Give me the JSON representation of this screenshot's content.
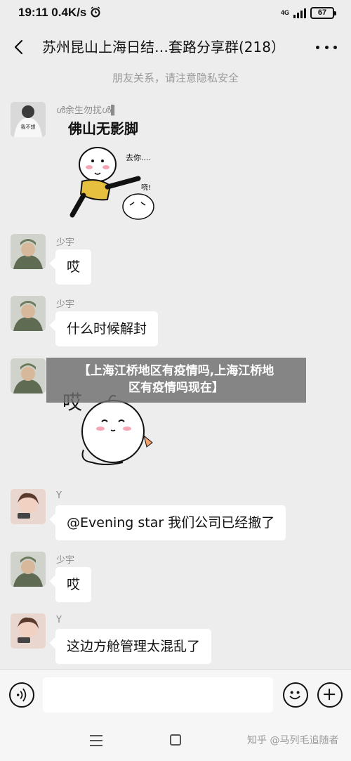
{
  "status": {
    "time": "19:11",
    "speed": "0.4K/s",
    "network": "4G",
    "battery": "67"
  },
  "header": {
    "title": "苏州昆山上海日结…套路分享群(218）"
  },
  "notice": "朋友关系，请注意隐私安全",
  "sticker_texts": {
    "foshan_title": "佛山无影脚",
    "qu_ni": "去你....",
    "xiao": "哓!",
    "ai": "哎"
  },
  "messages": [
    {
      "sender": "ൾ余生勿扰ൾ▌",
      "type": "sticker"
    },
    {
      "sender": "少宇",
      "text": "哎"
    },
    {
      "sender": "少宇",
      "text": "什么时候解封"
    },
    {
      "sender": "少宇",
      "type": "sticker"
    },
    {
      "sender": "Y",
      "text": "@Evening star  我们公司已经撤了"
    },
    {
      "sender": "少宇",
      "text": "哎"
    },
    {
      "sender": "Y",
      "text": "这边方舱管理太混乱了"
    }
  ],
  "banner": {
    "line1": "【上海江桥地区有疫情吗,上海江桥地",
    "line2": "区有疫情吗现在】"
  },
  "input": {
    "value": ""
  },
  "watermark": "知乎 @马列毛追随者",
  "colors": {
    "background": "#ededed",
    "bubble": "#ffffff",
    "banner": "#6e6e6e"
  },
  "icons": [
    "back-icon",
    "more-icon",
    "voice-icon",
    "emoji-icon",
    "plus-icon"
  ]
}
